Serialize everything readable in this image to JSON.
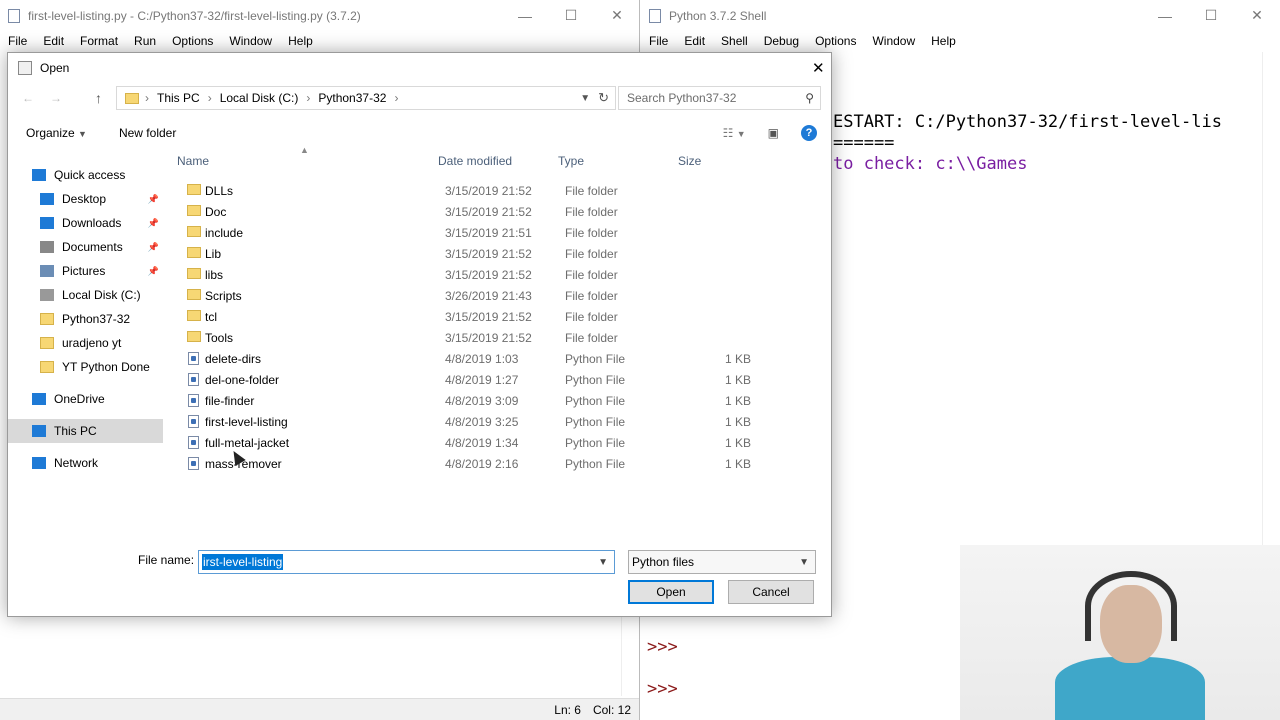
{
  "editor": {
    "title": "first-level-listing.py - C:/Python37-32/first-level-listing.py (3.7.2)",
    "menu": [
      "File",
      "Edit",
      "Format",
      "Run",
      "Options",
      "Window",
      "Help"
    ],
    "status_line": "Ln: 6",
    "status_col": "Col: 12"
  },
  "shell": {
    "title": "Python 3.7.2 Shell",
    "menu": [
      "File",
      "Edit",
      "Shell",
      "Debug",
      "Options",
      "Window",
      "Help"
    ],
    "line1": "ESTART: C:/Python37-32/first-level-lis",
    "line2": "======",
    "line3": "to check: c:\\\\Games",
    "prompt1": ">>>",
    "prompt2": ">>>"
  },
  "dialog": {
    "title": "Open",
    "breadcrumb": [
      "This PC",
      "Local Disk (C:)",
      "Python37-32"
    ],
    "search_placeholder": "Search Python37-32",
    "organize_label": "Organize",
    "new_folder_label": "New folder",
    "nav": [
      {
        "label": "Quick access",
        "icon": "star-icon",
        "level": 0
      },
      {
        "label": "Desktop",
        "icon": "desktop-icon",
        "level": 1,
        "pinned": true
      },
      {
        "label": "Downloads",
        "icon": "download-icon",
        "level": 1,
        "pinned": true
      },
      {
        "label": "Documents",
        "icon": "documents-icon",
        "level": 1,
        "pinned": true
      },
      {
        "label": "Pictures",
        "icon": "pictures-icon",
        "level": 1,
        "pinned": true
      },
      {
        "label": "Local Disk (C:)",
        "icon": "drive-icon",
        "level": 1
      },
      {
        "label": "Python37-32",
        "icon": "folder-icon",
        "level": 1
      },
      {
        "label": "uradjeno yt",
        "icon": "folder-icon",
        "level": 1
      },
      {
        "label": "YT Python Done",
        "icon": "folder-icon",
        "level": 1
      },
      {
        "label": "OneDrive",
        "icon": "cloud-icon",
        "level": 0
      },
      {
        "label": "This PC",
        "icon": "computer-icon",
        "level": 0,
        "selected": true
      },
      {
        "label": "Network",
        "icon": "network-icon",
        "level": 0
      }
    ],
    "columns": [
      "Name",
      "Date modified",
      "Type",
      "Size"
    ],
    "files": [
      {
        "name": "DLLs",
        "date": "3/15/2019 21:52",
        "type": "File folder",
        "size": "",
        "kind": "folder"
      },
      {
        "name": "Doc",
        "date": "3/15/2019 21:52",
        "type": "File folder",
        "size": "",
        "kind": "folder"
      },
      {
        "name": "include",
        "date": "3/15/2019 21:51",
        "type": "File folder",
        "size": "",
        "kind": "folder"
      },
      {
        "name": "Lib",
        "date": "3/15/2019 21:52",
        "type": "File folder",
        "size": "",
        "kind": "folder"
      },
      {
        "name": "libs",
        "date": "3/15/2019 21:52",
        "type": "File folder",
        "size": "",
        "kind": "folder"
      },
      {
        "name": "Scripts",
        "date": "3/26/2019 21:43",
        "type": "File folder",
        "size": "",
        "kind": "folder"
      },
      {
        "name": "tcl",
        "date": "3/15/2019 21:52",
        "type": "File folder",
        "size": "",
        "kind": "folder"
      },
      {
        "name": "Tools",
        "date": "3/15/2019 21:52",
        "type": "File folder",
        "size": "",
        "kind": "folder"
      },
      {
        "name": "delete-dirs",
        "date": "4/8/2019 1:03",
        "type": "Python File",
        "size": "1 KB",
        "kind": "py"
      },
      {
        "name": "del-one-folder",
        "date": "4/8/2019 1:27",
        "type": "Python File",
        "size": "1 KB",
        "kind": "py"
      },
      {
        "name": "file-finder",
        "date": "4/8/2019 3:09",
        "type": "Python File",
        "size": "1 KB",
        "kind": "py"
      },
      {
        "name": "first-level-listing",
        "date": "4/8/2019 3:25",
        "type": "Python File",
        "size": "1 KB",
        "kind": "py"
      },
      {
        "name": "full-metal-jacket",
        "date": "4/8/2019 1:34",
        "type": "Python File",
        "size": "1 KB",
        "kind": "py"
      },
      {
        "name": "mass-remover",
        "date": "4/8/2019 2:16",
        "type": "Python File",
        "size": "1 KB",
        "kind": "py"
      }
    ],
    "file_name_label": "File name:",
    "file_name_value": "irst-level-listing",
    "file_type_value": "Python files",
    "open_label": "Open",
    "cancel_label": "Cancel"
  }
}
